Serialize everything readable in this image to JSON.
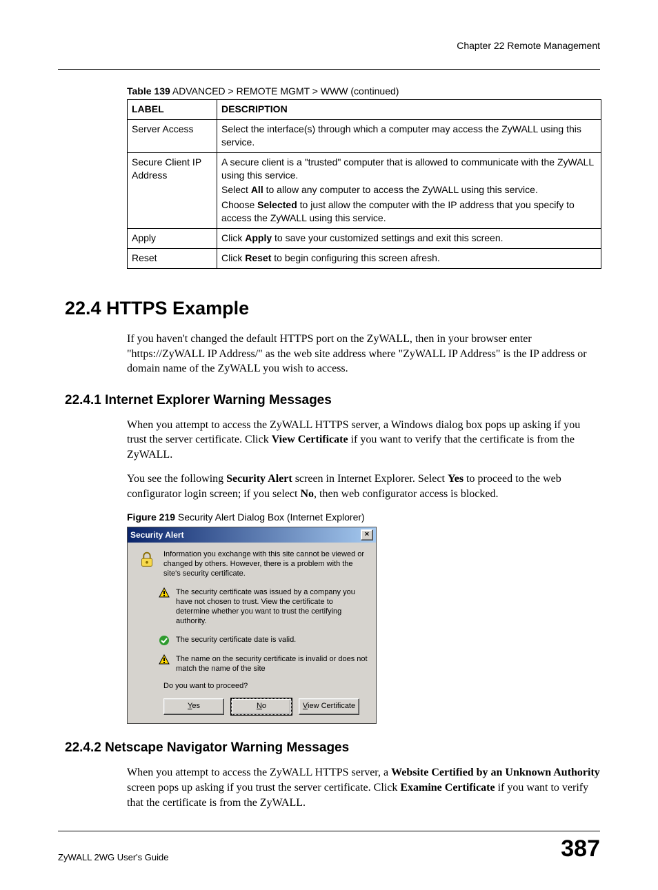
{
  "header": {
    "chapter": "Chapter 22 Remote Management"
  },
  "table": {
    "caption_bold": "Table 139",
    "caption_rest": "   ADVANCED > REMOTE MGMT > WWW (continued)",
    "head_label": "LABEL",
    "head_desc": "DESCRIPTION",
    "rows": {
      "r0": {
        "label": "Server Access",
        "d0": "Select the interface(s) through which a computer may access the ZyWALL using this service."
      },
      "r1": {
        "label": "Secure Client IP Address",
        "d0": "A secure client is a \"trusted\" computer that is allowed to communicate with the ZyWALL using this service.",
        "d1_pre": "Select ",
        "d1_b": "All",
        "d1_post": " to allow any computer to access the ZyWALL using this service.",
        "d2_pre": "Choose ",
        "d2_b": "Selected",
        "d2_post": " to just allow the computer with the IP address that you specify to access the ZyWALL using this service."
      },
      "r2": {
        "label": "Apply",
        "d0_pre": "Click ",
        "d0_b": "Apply",
        "d0_post": " to save your customized settings and exit this screen."
      },
      "r3": {
        "label": "Reset",
        "d0_pre": "Click ",
        "d0_b": "Reset",
        "d0_post": " to begin configuring this screen afresh."
      }
    }
  },
  "s224": {
    "heading": "22.4  HTTPS Example",
    "p1": "If you haven't changed the default HTTPS port on the ZyWALL, then in your browser enter \"https://ZyWALL IP Address/\" as the web site address where \"ZyWALL IP Address\" is the IP address or domain name of the ZyWALL you wish to access."
  },
  "s2241": {
    "heading": "22.4.1  Internet Explorer Warning Messages",
    "p1_pre": "When you attempt to access the ZyWALL HTTPS server, a Windows dialog box pops up asking if you trust the server certificate. Click ",
    "p1_b": "View Certificate",
    "p1_post": " if you want to verify that the certificate is from the ZyWALL.",
    "p2_a": "You see the following ",
    "p2_b1": "Security Alert",
    "p2_c": " screen in Internet Explorer. Select ",
    "p2_b2": "Yes",
    "p2_d": " to proceed to the web configurator login screen; if you select ",
    "p2_b3": "No",
    "p2_e": ", then web configurator access is blocked."
  },
  "figure": {
    "caption_bold": "Figure 219",
    "caption_rest": "   Security Alert Dialog Box (Internet Explorer)"
  },
  "dialog": {
    "title": "Security Alert",
    "close_glyph": "×",
    "msg_main": "Information you exchange with this site cannot be viewed or changed by others. However, there is a problem with the site's security certificate.",
    "msg_warn1": "The security certificate was issued by a company you have not chosen to trust. View the certificate to determine whether you want to trust the certifying authority.",
    "msg_ok": "The security certificate date is valid.",
    "msg_warn2": "The name on the security certificate is invalid or does not match the name of the site",
    "question": "Do you want to proceed?",
    "btn_yes_u": "Y",
    "btn_yes_rest": "es",
    "btn_no_u": "N",
    "btn_no_rest": "o",
    "btn_view_u": "V",
    "btn_view_rest": "iew Certificate"
  },
  "s2242": {
    "heading": "22.4.2  Netscape Navigator Warning Messages",
    "p1_a": "When you attempt to access the ZyWALL HTTPS server, a ",
    "p1_b1": "Website Certified by an Unknown Authority",
    "p1_c": " screen pops up asking if you trust the server certificate. Click ",
    "p1_b2": "Examine Certificate",
    "p1_d": " if you want to verify that the certificate is from the ZyWALL."
  },
  "footer": {
    "guide": "ZyWALL 2WG User's Guide",
    "page": "387"
  }
}
